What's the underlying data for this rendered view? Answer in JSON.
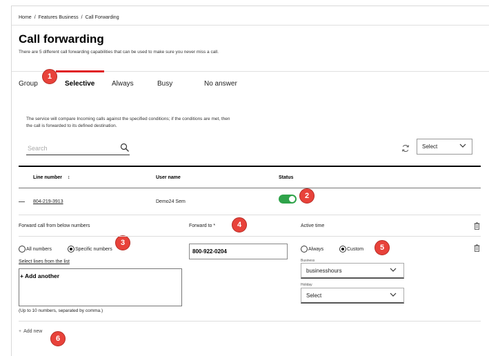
{
  "breadcrumb": {
    "items": [
      "Home",
      "Features Business",
      "Call Forwarding"
    ],
    "separator": "/"
  },
  "page": {
    "title": "Call forwarding",
    "subtitle": "There are 5 different call forwarding capabilities that can be used to make sure you never miss a call."
  },
  "tabs": [
    {
      "label": "Group",
      "active": false
    },
    {
      "label": "Selective",
      "active": true
    },
    {
      "label": "Always",
      "active": false
    },
    {
      "label": "Busy",
      "active": false
    },
    {
      "label": "No answer",
      "active": false
    }
  ],
  "badges": [
    "1",
    "2",
    "3",
    "4",
    "5",
    "6"
  ],
  "description": "The service will compare Incoming calls against the specified conditions; if the conditions are met, then the call is forwarded to its defined destination.",
  "search": {
    "placeholder": "Search"
  },
  "top_select": {
    "value": "Select"
  },
  "table": {
    "headers": {
      "line_number": "Line number",
      "sort_icon": "↕",
      "user_name": "User name",
      "status": "Status"
    },
    "row": {
      "dash": "—",
      "line_number": "804-219-3913",
      "user_name": "Demo24 Sem",
      "status_on": true
    }
  },
  "forward_section": {
    "from_label": "Forward call from below numbers",
    "to_label": "Forward to *",
    "active_time_label": "Active time",
    "all_numbers_label": "All numbers",
    "specific_numbers_label": "Specific numbers",
    "selected_numbers_option": "specific",
    "select_lines_link": "Select lines from the list",
    "add_another": "+ Add another",
    "hint": "(Up to 10 numbers, separated by comma.)",
    "forward_to_value": "800-922-0204",
    "always_label": "Always",
    "custom_label": "Custom",
    "selected_time_option": "custom",
    "business_label": "Business",
    "business_value": "businesshours",
    "holiday_label": "Holiday",
    "holiday_value": "Select"
  },
  "add_new": {
    "plus": "+",
    "label": "Add new"
  },
  "colors": {
    "accent": "#e01b22",
    "badge": "#e8423a",
    "toggle_on": "#2fa34a"
  }
}
